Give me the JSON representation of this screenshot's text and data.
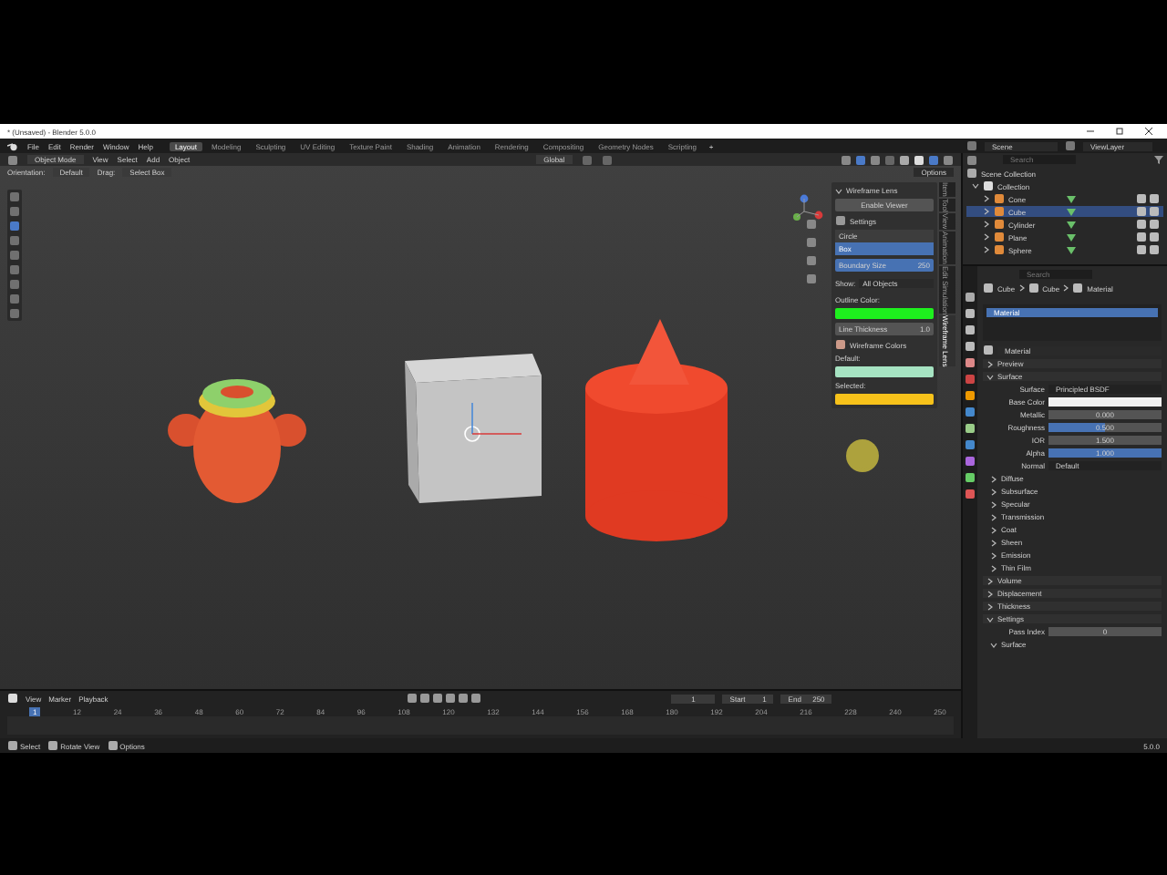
{
  "title_bar": {
    "title": "* (Unsaved) - Blender 5.0.0"
  },
  "menu": [
    "File",
    "Edit",
    "Render",
    "Window",
    "Help"
  ],
  "workspaces": [
    {
      "label": "Layout",
      "selected": true
    },
    {
      "label": "Modeling",
      "selected": false
    },
    {
      "label": "Sculpting",
      "selected": false
    },
    {
      "label": "UV Editing",
      "selected": false
    },
    {
      "label": "Texture Paint",
      "selected": false
    },
    {
      "label": "Shading",
      "selected": false
    },
    {
      "label": "Animation",
      "selected": false
    },
    {
      "label": "Rendering",
      "selected": false
    },
    {
      "label": "Compositing",
      "selected": false
    },
    {
      "label": "Geometry Nodes",
      "selected": false
    },
    {
      "label": "Scripting",
      "selected": false
    }
  ],
  "add_workspace": "+",
  "scene": "Scene",
  "view_layer": "ViewLayer",
  "viewport": {
    "mode": "Object Mode",
    "menus": [
      "View",
      "Select",
      "Add",
      "Object"
    ],
    "transform": "Global",
    "options": "Options",
    "orientation_label": "Orientation:",
    "orientation": "Default",
    "drag_label": "Drag:",
    "drag": "Select Box"
  },
  "n_panel": {
    "title": "Wireframe Lens",
    "enable_button": "Enable Viewer",
    "settings": "Settings",
    "shapes": [
      {
        "label": "Circle",
        "selected": false
      },
      {
        "label": "Box",
        "selected": true
      }
    ],
    "boundary_label": "Boundary Size",
    "boundary_value": "250",
    "show_label": "Show:",
    "show_value": "All Objects",
    "outline": {
      "label": "Outline Color:",
      "color": "#1ef01e"
    },
    "thickness_label": "Line Thickness",
    "thickness_value": "1.0",
    "colors_title": "Wireframe Colors",
    "wire_colors": [
      {
        "label": "Default:",
        "color": "#a6e3c2"
      },
      {
        "label": "Selected:",
        "color": "#f7c21a"
      }
    ],
    "tabs": [
      {
        "label": "Item",
        "selected": false
      },
      {
        "label": "Tool",
        "selected": false
      },
      {
        "label": "View",
        "selected": false
      },
      {
        "label": "Animation",
        "selected": false
      },
      {
        "label": "Edit Simulation",
        "selected": false
      },
      {
        "label": "Wireframe Lens",
        "selected": true
      }
    ]
  },
  "timeline": {
    "menus": [
      "View",
      "Marker",
      "Playback"
    ],
    "frame": "1",
    "start_label": "Start",
    "start": "1",
    "end_label": "End",
    "end": "250",
    "current": "1",
    "ticks": [
      "12",
      "24",
      "36",
      "48",
      "60",
      "72",
      "84",
      "96",
      "108",
      "120",
      "132",
      "144",
      "156",
      "168",
      "180",
      "192",
      "204",
      "216",
      "228",
      "240",
      "250"
    ]
  },
  "status_bar": {
    "items": [
      "Select",
      "Rotate View",
      "Options"
    ],
    "version": "5.0.0"
  },
  "outliner": {
    "search_placeholder": "Search",
    "root": "Scene Collection",
    "collection": {
      "label": "Collection",
      "expanded": true,
      "children": [
        {
          "label": "Cone",
          "selected": false
        },
        {
          "label": "Cube",
          "selected": true
        },
        {
          "label": "Cylinder",
          "selected": false
        },
        {
          "label": "Plane",
          "selected": false
        },
        {
          "label": "Sphere",
          "selected": false
        }
      ]
    }
  },
  "properties": {
    "search_placeholder": "Search",
    "breadcrumb": [
      "Cube",
      "Cube",
      "Material"
    ],
    "slots": [
      {
        "label": "Material",
        "selected": true
      }
    ],
    "material": "Material",
    "sections": [
      {
        "label": "Preview",
        "expanded": false
      },
      {
        "label": "Surface",
        "expanded": true
      }
    ],
    "surface_label": "Surface",
    "surface_value": "Principled BSDF",
    "fields": [
      {
        "kind": "color",
        "label": "Base Color",
        "color": "#f2f2f2"
      },
      {
        "kind": "value",
        "label": "Metallic",
        "value": "0.000"
      },
      {
        "kind": "number",
        "label": "Roughness",
        "value": "0.500",
        "level": 0.5
      },
      {
        "kind": "value",
        "label": "IOR",
        "value": "1.500"
      },
      {
        "kind": "number",
        "label": "Alpha",
        "value": "1.000",
        "level": 1
      },
      {
        "kind": "link",
        "label": "Normal",
        "value": "Default"
      }
    ],
    "subpanels": [
      "Diffuse",
      "Subsurface",
      "Specular",
      "Transmission",
      "Coat",
      "Sheen",
      "Emission",
      "Thin Film"
    ],
    "more": [
      {
        "label": "Volume",
        "expanded": false
      },
      {
        "label": "Displacement",
        "expanded": false
      },
      {
        "label": "Thickness",
        "expanded": false
      },
      {
        "label": "Settings",
        "expanded": true
      }
    ],
    "pass_label": "Pass Index",
    "pass_value": "0",
    "sub_surface": "Surface"
  }
}
